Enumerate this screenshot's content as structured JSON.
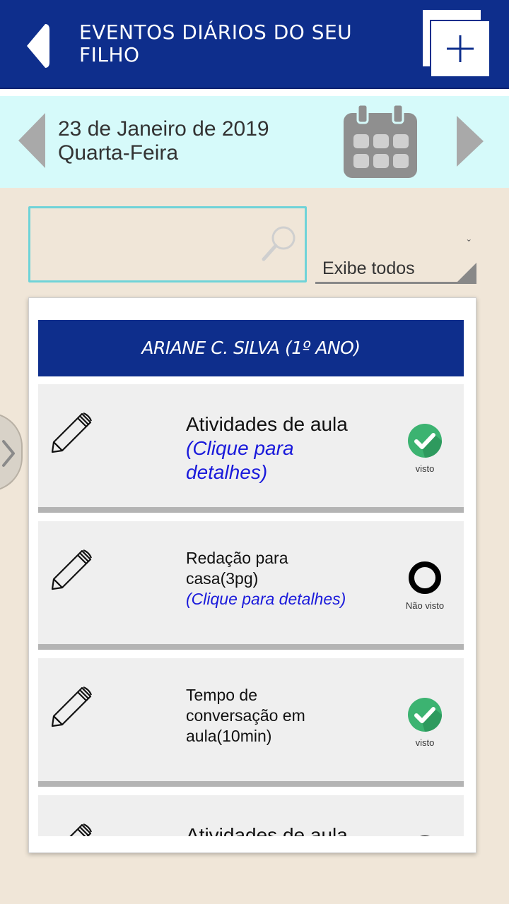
{
  "header": {
    "title": "EVENTOS DIÁRIOS DO SEU FILHO"
  },
  "datebar": {
    "date_line": "23 de Janeiro de 2019",
    "weekday": "Quarta-Feira"
  },
  "filter": {
    "search_value": "",
    "select_value": "Exibe todos"
  },
  "student": {
    "name": "ARIANE C. SILVA (1º ANO)"
  },
  "events": [
    {
      "title": "Atividades de aula",
      "link": "(Clique para detalhes)",
      "status": "visto"
    },
    {
      "title": "Redação para casa(3pg)",
      "link": "(Clique para detalhes)",
      "status": "Não visto"
    },
    {
      "title": "Tempo de conversação em aula(10min)",
      "link": "",
      "status": "visto"
    },
    {
      "title": "Atividades de aula",
      "link": "",
      "status": ""
    }
  ],
  "colors": {
    "primary": "#0e2e8c",
    "datebar_bg": "#d6fafa",
    "page_bg": "#f0e6d8",
    "seen_green": "#3cb371",
    "link_blue": "#1a1adb"
  }
}
